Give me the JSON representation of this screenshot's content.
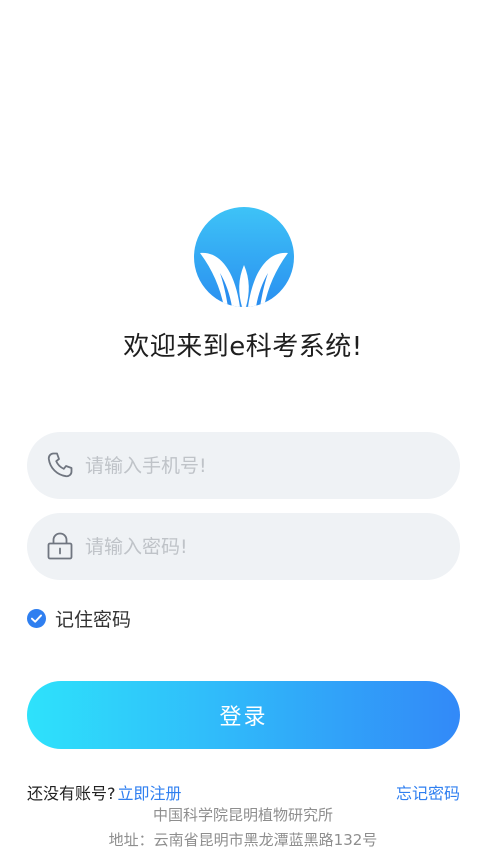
{
  "app": {
    "welcome_text": "欢迎来到e科考系统!"
  },
  "logo": {
    "icon": "leaf-logo-icon",
    "color": "#2f9cf0"
  },
  "form": {
    "phone": {
      "icon": "phone-icon",
      "value": "",
      "placeholder": "请输入手机号!"
    },
    "password": {
      "icon": "lock-icon",
      "value": "",
      "placeholder": "请输入密码!"
    },
    "remember": {
      "label": "记住密码",
      "checked": true,
      "icon": "checkbox-checked-icon"
    },
    "login_label": "登录"
  },
  "links": {
    "no_account": "还没有账号?",
    "register": "立即注册",
    "forgot": "忘记密码"
  },
  "footer": {
    "organization": "中国科学院昆明植物研究所",
    "address": "地址：云南省昆明市黑龙潭蓝黑路132号"
  },
  "colors": {
    "accent": "#2f7ff0",
    "gradient_start": "#2ee2fb",
    "gradient_end": "#3289f8",
    "field_bg": "#eff2f5"
  }
}
